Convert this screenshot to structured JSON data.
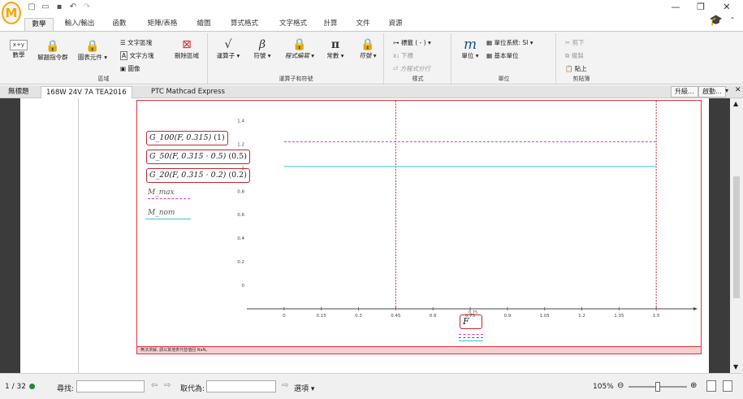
{
  "app": {
    "logo": "M"
  },
  "qat": {
    "new_icon": "new-file-icon",
    "open_icon": "open-folder-icon",
    "save_icon": "save-icon",
    "undo_icon": "undo-icon",
    "redo_icon": "redo-icon"
  },
  "ribbon_tabs": [
    "數學",
    "輸入/輸出",
    "函數",
    "矩陣/表格",
    "繪圖",
    "算式格式",
    "文字格式",
    "計算",
    "文件",
    "資源"
  ],
  "ribbon": {
    "regions": {
      "math": "數學",
      "solve_block": "解題指令群",
      "chart_component": "圖表元件",
      "text_region": "文字區塊",
      "text_box": "文字方塊",
      "image": "圖像",
      "delete_region": "刪除區域",
      "label": "區域"
    },
    "operators": {
      "operators": "運算子",
      "symbols": "符號",
      "programming": "程式編寫",
      "constants": "常數",
      "symbols2": "符號",
      "label": "運算子和符號"
    },
    "style": {
      "label_btn": "標籤 ( - )",
      "subscript": "下標",
      "line_break": "方程式分行",
      "label": "樣式"
    },
    "units": {
      "units": "單位",
      "unit_system": "單位系統: SI",
      "base_units": "基本單位",
      "label": "單位"
    },
    "clipboard": {
      "cut": "剪下",
      "copy": "複製",
      "paste": "貼上",
      "label": "剪貼簿"
    }
  },
  "doc_tabs": [
    "無標題",
    "168W 24V 7A TEA2016"
  ],
  "doc_title": "PTC Mathcad Express",
  "buttons": {
    "upgrade": "升級...",
    "activate": "啟動..."
  },
  "math": {
    "g100_fn": "G_100",
    "g100_args": "F, 0.315",
    "g100_p": "(1)",
    "g50_fn": "G_50",
    "g50_args": "F, 0.315 · 0.5",
    "g50_p": "(0.5)",
    "g20_fn": "G_20",
    "g20_args": "F, 0.315 · 0.2",
    "g20_p": "(0.2)",
    "legend_max": "M_max",
    "legend_nom": "M_nom",
    "x_var": "F",
    "x_small": "0.75"
  },
  "error": "無法求解, 請以其他表代替值回 NaN。",
  "chart_data": {
    "type": "line",
    "x_ticks": [
      "0",
      "0.15",
      "0.3",
      "0.45",
      "0.6",
      "0.75",
      "0.9",
      "1.05",
      "1.2",
      "1.35",
      "1.5"
    ],
    "y_ticks": [
      "1.4",
      "1.2",
      "1",
      "0.8",
      "0.6",
      "0.4",
      "0.2",
      "0"
    ],
    "xlim": [
      -0.15,
      1.65
    ],
    "ylim": [
      -0.2,
      1.5
    ],
    "series": [
      {
        "name": "M_max",
        "values": [
          {
            "x": 0,
            "y": 1.22
          },
          {
            "x": 1.5,
            "y": 1.22
          }
        ],
        "color": "#d63bd6",
        "dash": true
      },
      {
        "name": "M_nom",
        "values": [
          {
            "x": 0,
            "y": 1.01
          },
          {
            "x": 1.5,
            "y": 1.01
          }
        ],
        "color": "#35c8d8",
        "dash": false
      }
    ],
    "vlines": [
      0.45,
      1.5
    ],
    "vline_color": "#c0282f"
  },
  "status": {
    "page": "1 / 32",
    "find_label": "尋找:",
    "replace_label": "取代為:",
    "options": "選項",
    "zoom": "105%"
  }
}
